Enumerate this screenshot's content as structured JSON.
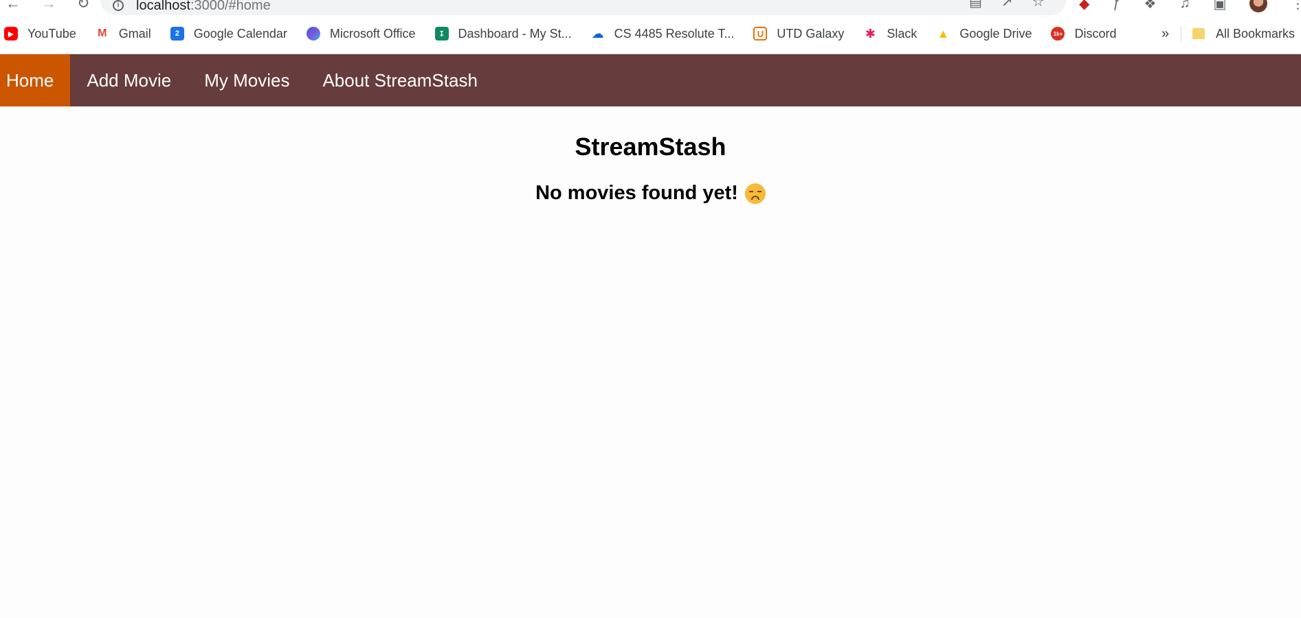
{
  "browser": {
    "url_host": "localhost",
    "url_path": ":3000/#home",
    "bookmarks": [
      {
        "label": "YouTube",
        "icon": "youtube-icon"
      },
      {
        "label": "Gmail",
        "icon": "gmail-icon"
      },
      {
        "label": "Google Calendar",
        "icon": "calendar-icon"
      },
      {
        "label": "Microsoft Office",
        "icon": "office-icon"
      },
      {
        "label": "Dashboard - My St...",
        "icon": "dashboard-icon"
      },
      {
        "label": "CS 4485 Resolute T...",
        "icon": "onedrive-icon"
      },
      {
        "label": "UTD Galaxy",
        "icon": "utd-icon"
      },
      {
        "label": "Slack",
        "icon": "slack-icon"
      },
      {
        "label": "Google Drive",
        "icon": "drive-icon"
      },
      {
        "label": "Discord",
        "icon": "discord-icon"
      }
    ],
    "more_bookmarks": "»",
    "all_bookmarks": "All Bookmarks"
  },
  "nav": {
    "items": [
      {
        "label": "Home",
        "active": true
      },
      {
        "label": "Add Movie",
        "active": false
      },
      {
        "label": "My Movies",
        "active": false
      },
      {
        "label": "About StreamStash",
        "active": false
      }
    ],
    "bg_color": "#663c3d",
    "active_color": "#cc5500"
  },
  "main": {
    "title": "StreamStash",
    "empty_message": "No movies found yet!",
    "empty_icon": "sad-face-icon"
  }
}
